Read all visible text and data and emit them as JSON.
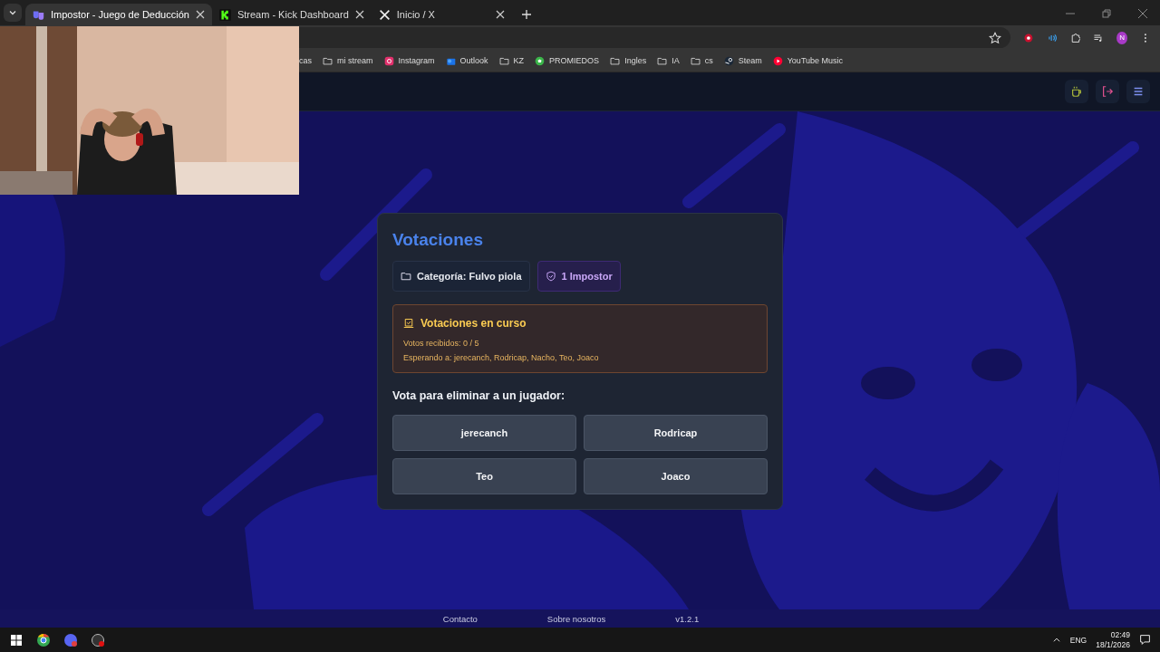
{
  "browser": {
    "tabs": [
      {
        "title": "Impostor - Juego de Deducción",
        "kind": "impostor",
        "selected": true
      },
      {
        "title": "Stream - Kick Dashboard",
        "kind": "kick",
        "selected": false
      },
      {
        "title": "Inicio / X",
        "kind": "x",
        "selected": false
      }
    ],
    "bookmarks": [
      {
        "label": "cas",
        "kind": "hidden"
      },
      {
        "label": "mi stream",
        "kind": "folder"
      },
      {
        "label": "Instagram",
        "kind": "instagram"
      },
      {
        "label": "Outlook",
        "kind": "outlook"
      },
      {
        "label": "KZ",
        "kind": "folder"
      },
      {
        "label": "PROMIEDOS",
        "kind": "ball"
      },
      {
        "label": "Ingles",
        "kind": "folder"
      },
      {
        "label": "IA",
        "kind": "folder"
      },
      {
        "label": "cs",
        "kind": "folder"
      },
      {
        "label": "Steam",
        "kind": "steam"
      },
      {
        "label": "YouTube Music",
        "kind": "music"
      }
    ],
    "profile_initial": "N"
  },
  "voting": {
    "title": "Votaciones",
    "category": "Categoría: Fulvo piola",
    "impostors": "1 Impostor",
    "status": {
      "title": "Votaciones en curso",
      "votes": "Votos recibidos: 0 / 5",
      "waiting": "Esperando a: jerecanch, Rodricap, Nacho, Teo, Joaco"
    },
    "prompt": "Vota para eliminar a un jugador:",
    "players": [
      "jerecanch",
      "Rodricap",
      "Teo",
      "Joaco"
    ]
  },
  "footer": {
    "links": [
      "Contacto",
      "Sobre nosotros"
    ],
    "version": "v1.2.1"
  },
  "taskbar": {
    "language": "ENG",
    "time": "02:49",
    "date": "18/1/2026"
  }
}
